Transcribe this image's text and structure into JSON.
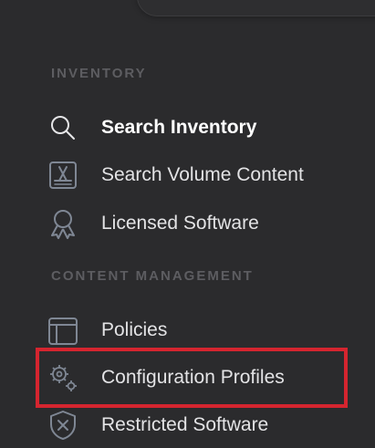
{
  "sidebar": {
    "sections": [
      {
        "header": "INVENTORY",
        "items": [
          {
            "label": "Search Inventory",
            "icon": "search-icon",
            "active": true
          },
          {
            "label": "Search Volume Content",
            "icon": "app-store-icon"
          },
          {
            "label": "Licensed Software",
            "icon": "award-ribbon-icon"
          }
        ]
      },
      {
        "header": "CONTENT MANAGEMENT",
        "items": [
          {
            "label": "Policies",
            "icon": "window-icon"
          },
          {
            "label": "Configuration Profiles",
            "icon": "gears-icon",
            "highlighted": true
          },
          {
            "label": "Restricted Software",
            "icon": "shield-x-icon"
          }
        ]
      }
    ]
  },
  "colors": {
    "background": "#2b2b2d",
    "section_header": "#5d5d61",
    "label": "#e3e3e5",
    "icon_muted": "#7f8794",
    "highlight": "#d5252f"
  }
}
